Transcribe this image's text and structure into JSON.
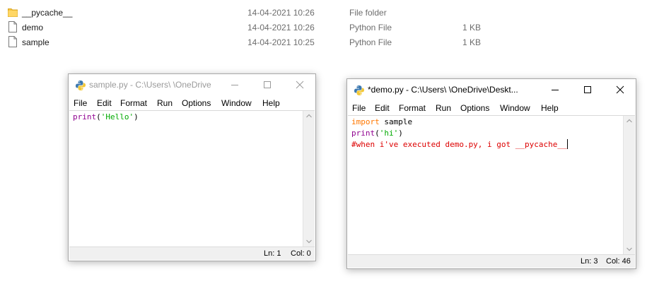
{
  "explorer": {
    "files": [
      {
        "name": "__pycache__",
        "date": "14-04-2021 10:26",
        "type": "File folder",
        "size": "",
        "icon": "folder-icon"
      },
      {
        "name": "demo",
        "date": "14-04-2021 10:26",
        "type": "Python File",
        "size": "1 KB",
        "icon": "file-icon"
      },
      {
        "name": "sample",
        "date": "14-04-2021 10:25",
        "type": "Python File",
        "size": "1 KB",
        "icon": "file-icon"
      }
    ]
  },
  "sample_window": {
    "title": "sample.py - C:\\Users\\      \\OneDrive",
    "menu": [
      "File",
      "Edit",
      "Format",
      "Run",
      "Options",
      "Window",
      "Help"
    ],
    "code": {
      "line1": {
        "fn": "print",
        "open": "(",
        "str": "'Hello'",
        "close": ")"
      }
    },
    "status": {
      "ln": "Ln: 1",
      "col": "Col: 0"
    }
  },
  "demo_window": {
    "title": "*demo.py - C:\\Users\\      \\OneDrive\\Deskt...",
    "menu": [
      "File",
      "Edit",
      "Format",
      "Run",
      "Options",
      "Window",
      "Help"
    ],
    "code": {
      "line1": {
        "kw": "import",
        "rest": " sample"
      },
      "line2": {
        "fn": "print",
        "open": "(",
        "str": "'hi'",
        "close": ")"
      },
      "line3": {
        "comment": "#when i've executed demo.py, i got __pycache__"
      }
    },
    "status": {
      "ln": "Ln: 3",
      "col": "Col: 46"
    }
  },
  "colors": {
    "keyword": "#ff7700",
    "builtin": "#900090",
    "string": "#00aa00",
    "comment": "#dd0000",
    "folder": "#f5c542"
  }
}
